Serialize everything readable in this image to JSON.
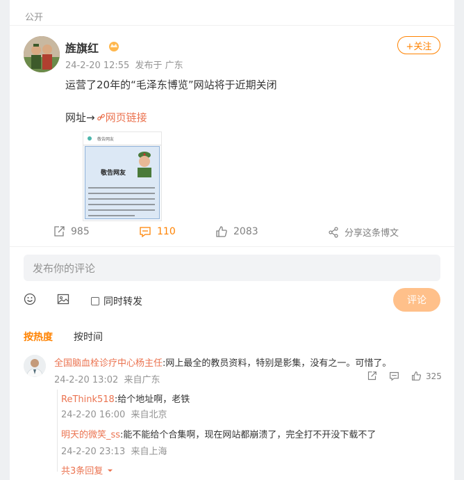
{
  "post": {
    "visibility": "公开",
    "author": "旌旗红",
    "timestamp": "24-2-20 12:55",
    "location": "发布于 广东",
    "follow_label": "+关注",
    "text": "运营了20年的“毛泽东博览”网站将于近期关闭",
    "url_prefix": "网址→",
    "link_text": "网页链接",
    "thumbnail": {
      "header": "敬告网友",
      "title": "敬告网友"
    }
  },
  "actions": {
    "reposts": "985",
    "comments": "110",
    "likes": "2083",
    "share_label": "分享这条博文"
  },
  "composer": {
    "placeholder": "发布你的评论",
    "repost_label": "同时转发",
    "submit_label": "评论"
  },
  "sort_tabs": {
    "hot": "按热度",
    "time": "按时间"
  },
  "comment": {
    "author": "全国脑血栓诊疗中心杨主任",
    "text": ":网上最全的教员资料，特别是影集，没有之一。可惜了。",
    "timestamp": "24-2-20 13:02",
    "location": "来自广东",
    "likes": "325",
    "replies": [
      {
        "author": "ReThink518",
        "text": ":给个地址啊，老铁",
        "timestamp": "24-2-20 16:00",
        "location": "来自北京"
      },
      {
        "author": "明天的微笑_ss",
        "text": ":能不能给个合集啊，现在网站都崩溃了，完全打不开没下载不了",
        "timestamp": "24-2-20 23:13",
        "location": "来自上海"
      }
    ],
    "more_replies": "共3条回复"
  },
  "colors": {
    "accent": "#ff8200",
    "link": "#eb7350",
    "submit_disabled": "#ffc08a"
  }
}
